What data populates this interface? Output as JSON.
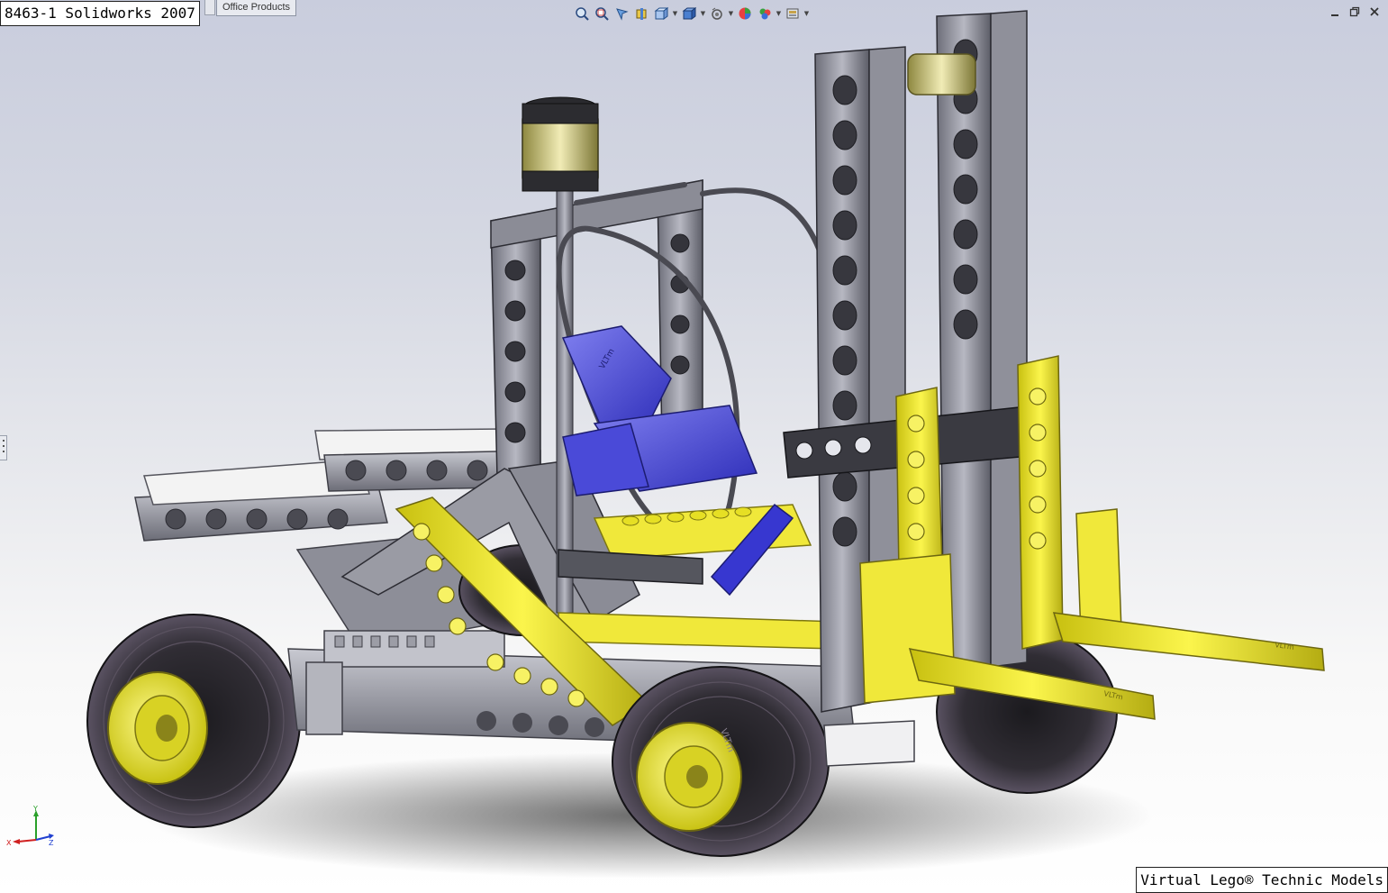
{
  "window": {
    "title": "8463-1 Solidworks 2007",
    "tab_label": "Office Products"
  },
  "toolbar": {
    "tools": [
      {
        "icon": "zoom-to-fit-icon"
      },
      {
        "icon": "zoom-to-area-icon"
      },
      {
        "icon": "previous-view-icon"
      },
      {
        "icon": "section-view-icon"
      },
      {
        "icon": "view-orientation-icon",
        "dropdown": true
      },
      {
        "icon": "display-style-icon",
        "dropdown": true
      },
      {
        "icon": "hide-show-items-icon",
        "dropdown": true
      },
      {
        "icon": "edit-appearance-icon"
      },
      {
        "icon": "apply-scene-icon",
        "dropdown": true
      },
      {
        "icon": "view-settings-icon",
        "dropdown": true
      }
    ]
  },
  "window_controls": [
    "minimize-icon",
    "restore-icon",
    "close-icon"
  ],
  "triad": {
    "x": "X",
    "y": "Y",
    "z": "Z"
  },
  "branding": {
    "caption": "Virtual Lego® Technic Models",
    "part_marking": "VLTm"
  },
  "colors": {
    "background_top": "#c9cddd",
    "background_bottom": "#ffffff",
    "beam_gray": "#a8a9b2",
    "beam_dark": "#3e3f47",
    "lego_yellow": "#f2ea2c",
    "seat_blue": "#4b4bd8",
    "tire_black": "#262428",
    "hub_yellow": "#e8e22a",
    "tile_white": "#f3f3f3"
  }
}
